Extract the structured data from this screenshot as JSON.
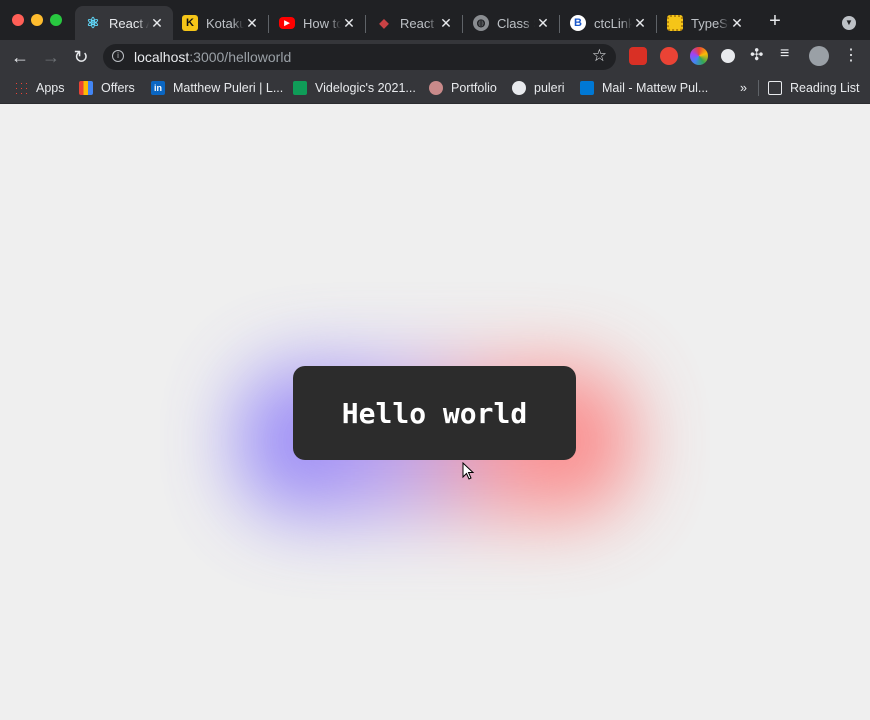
{
  "tabs": [
    {
      "title": "React App",
      "favicon": "react-icon",
      "active": true
    },
    {
      "title": "Kotaku",
      "favicon": "kotaku-icon",
      "active": false
    },
    {
      "title": "How to",
      "favicon": "youtube-icon",
      "active": false
    },
    {
      "title": "React Router",
      "favicon": "react-router-icon",
      "active": false
    },
    {
      "title": "Class Search",
      "favicon": "globe-icon",
      "active": false
    },
    {
      "title": "ctcLink",
      "favicon": "ctclink-icon",
      "active": false
    },
    {
      "title": "TypeScript",
      "favicon": "typescript-icon",
      "active": false
    }
  ],
  "toolbar": {
    "url_host": "localhost",
    "url_path": ":3000/helloworld"
  },
  "bookmarks": {
    "items": [
      {
        "label": "Apps",
        "icon": "apps-grid-icon"
      },
      {
        "label": "Offers",
        "icon": "offers-icon"
      },
      {
        "label": "Matthew Puleri | L...",
        "icon": "linkedin-icon"
      },
      {
        "label": "Videlogic's 2021...",
        "icon": "sheets-icon"
      },
      {
        "label": "Portfolio",
        "icon": "portfolio-icon"
      },
      {
        "label": "puleri",
        "icon": "github-icon"
      },
      {
        "label": "Mail - Mattew Pul...",
        "icon": "outlook-icon"
      }
    ],
    "overflow": "»",
    "reading_list": "Reading List"
  },
  "page": {
    "heading": "Hello world"
  },
  "colors": {
    "chrome_bg": "#202124",
    "toolbar_bg": "#35363a",
    "page_bg": "#efefef",
    "card_bg": "#2c2c2c",
    "glow_left": "#6b5cff",
    "glow_right": "#ff5a5a"
  }
}
